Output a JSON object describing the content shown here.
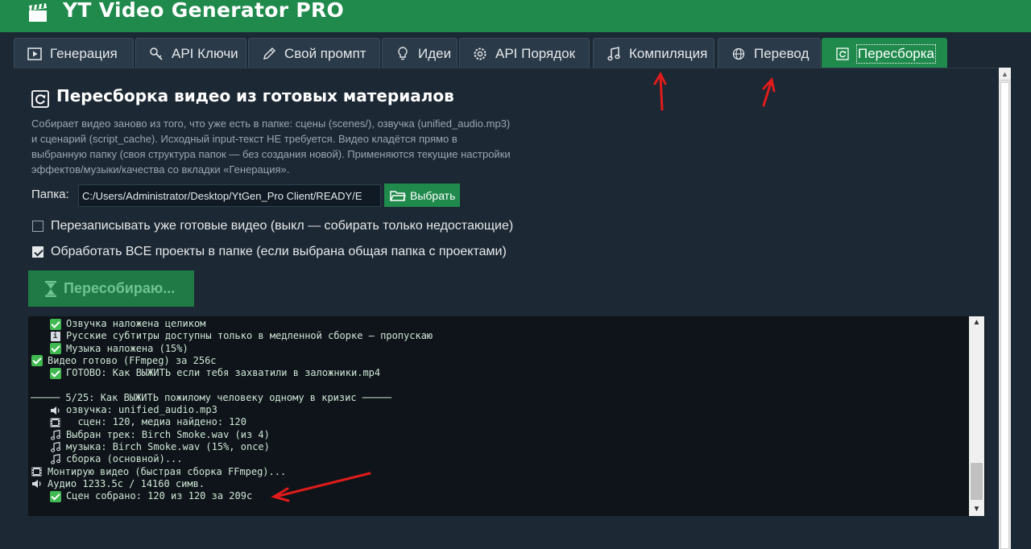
{
  "app": {
    "title": "YT Video Generator PRO"
  },
  "tabs": [
    {
      "label": "Генерация",
      "icon": "play-icon"
    },
    {
      "label": "API Ключи",
      "icon": "key-icon"
    },
    {
      "label": "Свой промпт",
      "icon": "pencil-icon"
    },
    {
      "label": "Идеи",
      "icon": "lightbulb-icon"
    },
    {
      "label": "API Порядок",
      "icon": "gear-icon"
    },
    {
      "label": "Компиляция",
      "icon": "music-note-icon"
    },
    {
      "label": "Перевод",
      "icon": "globe-icon"
    },
    {
      "label": "Пересборка",
      "icon": "rebuild-icon",
      "active": true
    }
  ],
  "section": {
    "title": "Пересборка видео из готовых материалов",
    "desc": [
      "Собирает видео заново из того, что уже есть в папке: сцены (scenes/), озвучка (unified_audio.mp3)",
      "и сценарий (script_cache). Исходный input-текст НЕ требуется. Видео кладётся прямо в",
      "выбранную папку (своя структура папок — без создания новой). Применяются текущие настройки",
      "эффектов/музыки/качества со вкладки «Генерация»."
    ]
  },
  "folder": {
    "label": "Папка:",
    "value": "C:/Users/Administrator/Desktop/YtGen_Pro Client/READY/E",
    "pick_label": "Выбрать"
  },
  "options": [
    {
      "label": "Перезаписывать уже готовые видео (выкл — собирать только недостающие)",
      "checked": false
    },
    {
      "label": "Обработать ВСЕ проекты в папке (если выбрана общая папка с проектами)",
      "checked": true
    }
  ],
  "rebuild_button": {
    "label": "Пересобираю..."
  },
  "log": [
    {
      "indent": 2,
      "icon": "check-icon",
      "text": "Озвучка наложена целиком"
    },
    {
      "indent": 2,
      "icon": "info-icon",
      "text": "Русские субтитры доступны только в медленной сборке — пропускаю"
    },
    {
      "indent": 2,
      "icon": "check-icon",
      "text": "Музыка наложена (15%)"
    },
    {
      "indent": 0,
      "icon": "check-icon",
      "text": "Видео готово (FFmpeg) за 256с"
    },
    {
      "indent": 2,
      "icon": "check-icon",
      "text": "ГОТОВО: Как ВЫЖИТЬ если тебя захватили в заложники.mp4"
    },
    {
      "indent": 0,
      "icon": "",
      "text": ""
    },
    {
      "indent": 0,
      "icon": "",
      "text": "───── 5/25: Как ВЫЖИТЬ пожилому человеку одному в кризис ─────"
    },
    {
      "indent": 2,
      "icon": "speaker-icon",
      "text": "озвучка: unified_audio.mp3"
    },
    {
      "indent": 2,
      "icon": "film-icon",
      "text": "  сцен: 120, медиа найдено: 120"
    },
    {
      "indent": 2,
      "icon": "music-note-icon",
      "text": "Выбран трек: Birch Smoke.wav (из 4)"
    },
    {
      "indent": 2,
      "icon": "music-note-icon",
      "text": "музыка: Birch Smoke.wav (15%, once)"
    },
    {
      "indent": 2,
      "icon": "music-note-icon",
      "text": "сборка (основной)..."
    },
    {
      "indent": 0,
      "icon": "film-icon",
      "text": "Монтирую видео (быстрая сборка FFmpeg)..."
    },
    {
      "indent": 0,
      "icon": "speaker-icon",
      "text": "Аудио 1233.5с / 14160 симв."
    },
    {
      "indent": 2,
      "icon": "check-icon",
      "text": "Сцен собрано: 120 из 120 за 209с"
    }
  ],
  "colors": {
    "accent": "#1f8a4c",
    "background": "#1c2833",
    "log_bg": "#0e1419",
    "annotation": "#e01b1b"
  }
}
